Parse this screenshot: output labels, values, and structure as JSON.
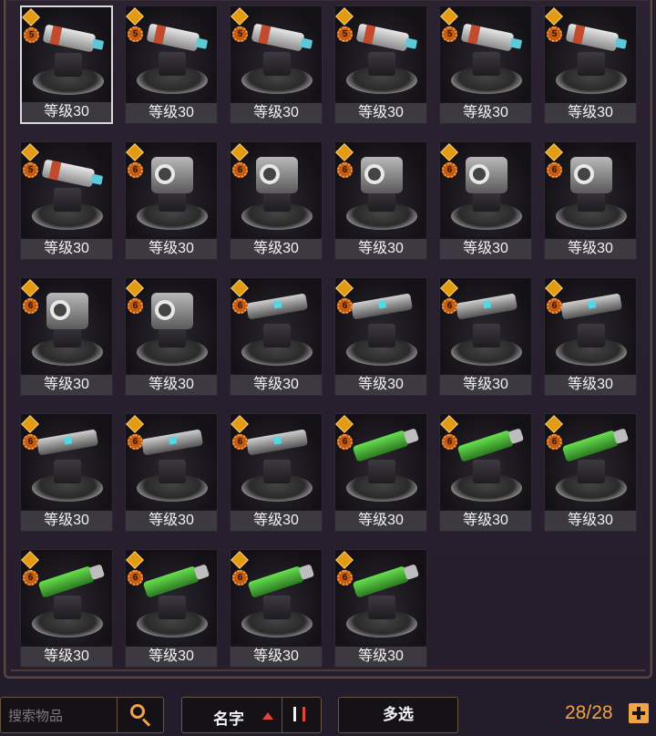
{
  "items": [
    {
      "level_label": "等级30",
      "tier": "5",
      "model": "t5",
      "selected": true
    },
    {
      "level_label": "等级30",
      "tier": "5",
      "model": "t5"
    },
    {
      "level_label": "等级30",
      "tier": "5",
      "model": "t5"
    },
    {
      "level_label": "等级30",
      "tier": "5",
      "model": "t5"
    },
    {
      "level_label": "等级30",
      "tier": "5",
      "model": "t5"
    },
    {
      "level_label": "等级30",
      "tier": "5",
      "model": "t5"
    },
    {
      "level_label": "等级30",
      "tier": "5",
      "model": "t5"
    },
    {
      "level_label": "等级30",
      "tier": "6",
      "model": "t6a"
    },
    {
      "level_label": "等级30",
      "tier": "6",
      "model": "t6a"
    },
    {
      "level_label": "等级30",
      "tier": "6",
      "model": "t6a"
    },
    {
      "level_label": "等级30",
      "tier": "6",
      "model": "t6a"
    },
    {
      "level_label": "等级30",
      "tier": "6",
      "model": "t6a"
    },
    {
      "level_label": "等级30",
      "tier": "6",
      "model": "t6a"
    },
    {
      "level_label": "等级30",
      "tier": "6",
      "model": "t6a"
    },
    {
      "level_label": "等级30",
      "tier": "6",
      "model": "t6b"
    },
    {
      "level_label": "等级30",
      "tier": "6",
      "model": "t6b"
    },
    {
      "level_label": "等级30",
      "tier": "6",
      "model": "t6b"
    },
    {
      "level_label": "等级30",
      "tier": "6",
      "model": "t6b"
    },
    {
      "level_label": "等级30",
      "tier": "6",
      "model": "t6b"
    },
    {
      "level_label": "等级30",
      "tier": "6",
      "model": "t6b"
    },
    {
      "level_label": "等级30",
      "tier": "6",
      "model": "t6b"
    },
    {
      "level_label": "等级30",
      "tier": "6",
      "model": "t6c"
    },
    {
      "level_label": "等级30",
      "tier": "6",
      "model": "t6c"
    },
    {
      "level_label": "等级30",
      "tier": "6",
      "model": "t6c"
    },
    {
      "level_label": "等级30",
      "tier": "6",
      "model": "t6c"
    },
    {
      "level_label": "等级30",
      "tier": "6",
      "model": "t6c"
    },
    {
      "level_label": "等级30",
      "tier": "6",
      "model": "t6c"
    },
    {
      "level_label": "等级30",
      "tier": "6",
      "model": "t6c"
    }
  ],
  "toolbar": {
    "search_placeholder": "搜索物品",
    "search_icon": "magnifier-icon",
    "sort_label": "名字",
    "sort_direction_icon": "triangle-up-icon",
    "sort_order_icon": "sort-order-icon",
    "multi_select_label": "多选",
    "item_count": "28/28",
    "add_icon": "plus-icon"
  },
  "colors": {
    "accent": "#f0a347",
    "sort_arrow": "#e0463a",
    "tier_badge": "#c35b12",
    "rank_icon": "#e39b14"
  }
}
